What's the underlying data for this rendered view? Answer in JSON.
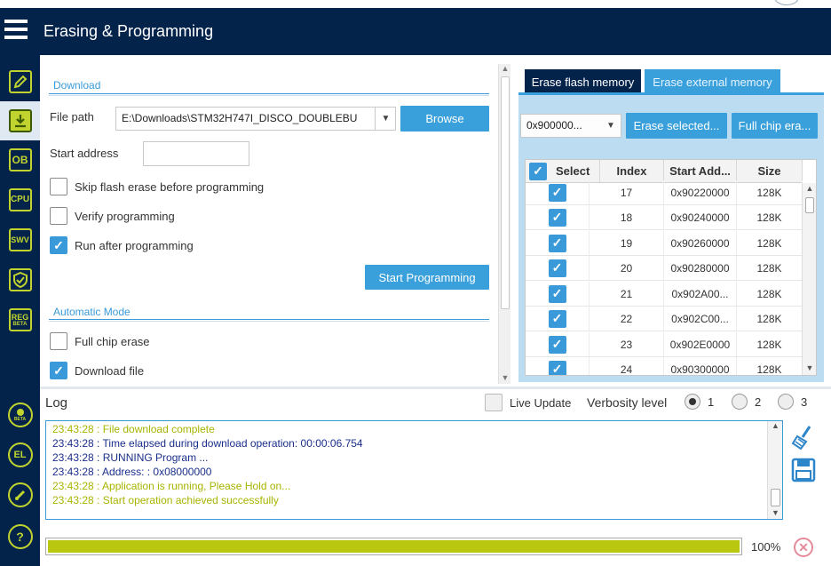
{
  "header": {
    "title": "Erasing & Programming"
  },
  "sidebar": {
    "items": [
      {
        "label": "",
        "icon": "edit-icon"
      },
      {
        "label": "",
        "icon": "download-icon"
      },
      {
        "label": "OB",
        "icon": "option-bytes-icon"
      },
      {
        "label": "CPU",
        "icon": "cpu-icon"
      },
      {
        "label": "SWV",
        "icon": "swv-icon"
      },
      {
        "label": "",
        "icon": "shield-icon"
      },
      {
        "label": "REG",
        "sub": "BETA",
        "icon": "register-icon"
      },
      {
        "label": "",
        "sub": "BETA",
        "icon": "bug-icon"
      },
      {
        "label": "EL",
        "icon": "external-loader-icon"
      },
      {
        "label": "",
        "icon": "chain-icon"
      },
      {
        "label": "?",
        "icon": "help-icon"
      }
    ]
  },
  "download": {
    "section_label": "Download",
    "file_path_label": "File path",
    "file_path_value": "E:\\Downloads\\STM32H747I_DISCO_DOUBLEBU",
    "browse_label": "Browse",
    "start_address_label": "Start address",
    "start_address_value": "",
    "checkboxes": [
      {
        "label": "Skip flash erase before programming",
        "checked": false
      },
      {
        "label": "Verify programming",
        "checked": false
      },
      {
        "label": "Run after programming",
        "checked": true
      }
    ],
    "start_programming_label": "Start Programming"
  },
  "automatic": {
    "section_label": "Automatic Mode",
    "checkboxes": [
      {
        "label": "Full chip erase",
        "checked": false
      },
      {
        "label": "Download file",
        "checked": true
      }
    ]
  },
  "erase": {
    "tabs": [
      {
        "label": "Erase flash memory",
        "active": true
      },
      {
        "label": "Erase external memory",
        "active": false
      }
    ],
    "address_select": "0x900000...",
    "erase_selected_label": "Erase selected...",
    "full_chip_erase_label": "Full chip era...",
    "columns": [
      "Select",
      "Index",
      "Start Add...",
      "Size"
    ],
    "rows": [
      {
        "index": "17",
        "address": "0x90220000",
        "size": "128K"
      },
      {
        "index": "18",
        "address": "0x90240000",
        "size": "128K"
      },
      {
        "index": "19",
        "address": "0x90260000",
        "size": "128K"
      },
      {
        "index": "20",
        "address": "0x90280000",
        "size": "128K"
      },
      {
        "index": "21",
        "address": "0x902A00...",
        "size": "128K"
      },
      {
        "index": "22",
        "address": "0x902C00...",
        "size": "128K"
      },
      {
        "index": "23",
        "address": "0x902E0000",
        "size": "128K"
      },
      {
        "index": "24",
        "address": "0x90300000",
        "size": "128K"
      }
    ]
  },
  "log": {
    "title": "Log",
    "live_update_label": "Live Update",
    "verbosity_label": "Verbosity level",
    "verbosity_options": [
      "1",
      "2",
      "3"
    ],
    "verbosity_selected": "1",
    "lines": [
      {
        "text": "23:43:28 : File download complete",
        "color": "#a8b400"
      },
      {
        "text": "23:43:28 : Time elapsed during download operation: 00:00:06.754",
        "color": "#1a2f8c"
      },
      {
        "text": "23:43:28 : RUNNING Program ...",
        "color": "#1a2f8c"
      },
      {
        "text": "23:43:28 :   Address:      : 0x08000000",
        "color": "#1a2f8c"
      },
      {
        "text": "23:43:28 : Application is running, Please Hold on...",
        "color": "#a8b400"
      },
      {
        "text": "23:43:28 : Start operation achieved successfully",
        "color": "#a8b400"
      }
    ],
    "progress_percent": 100,
    "progress_label": "100%"
  },
  "colors": {
    "navy": "#03234b",
    "accent_blue": "#3aa0dc",
    "lime": "#c1d32f",
    "progress_fill": "#b9c711"
  }
}
